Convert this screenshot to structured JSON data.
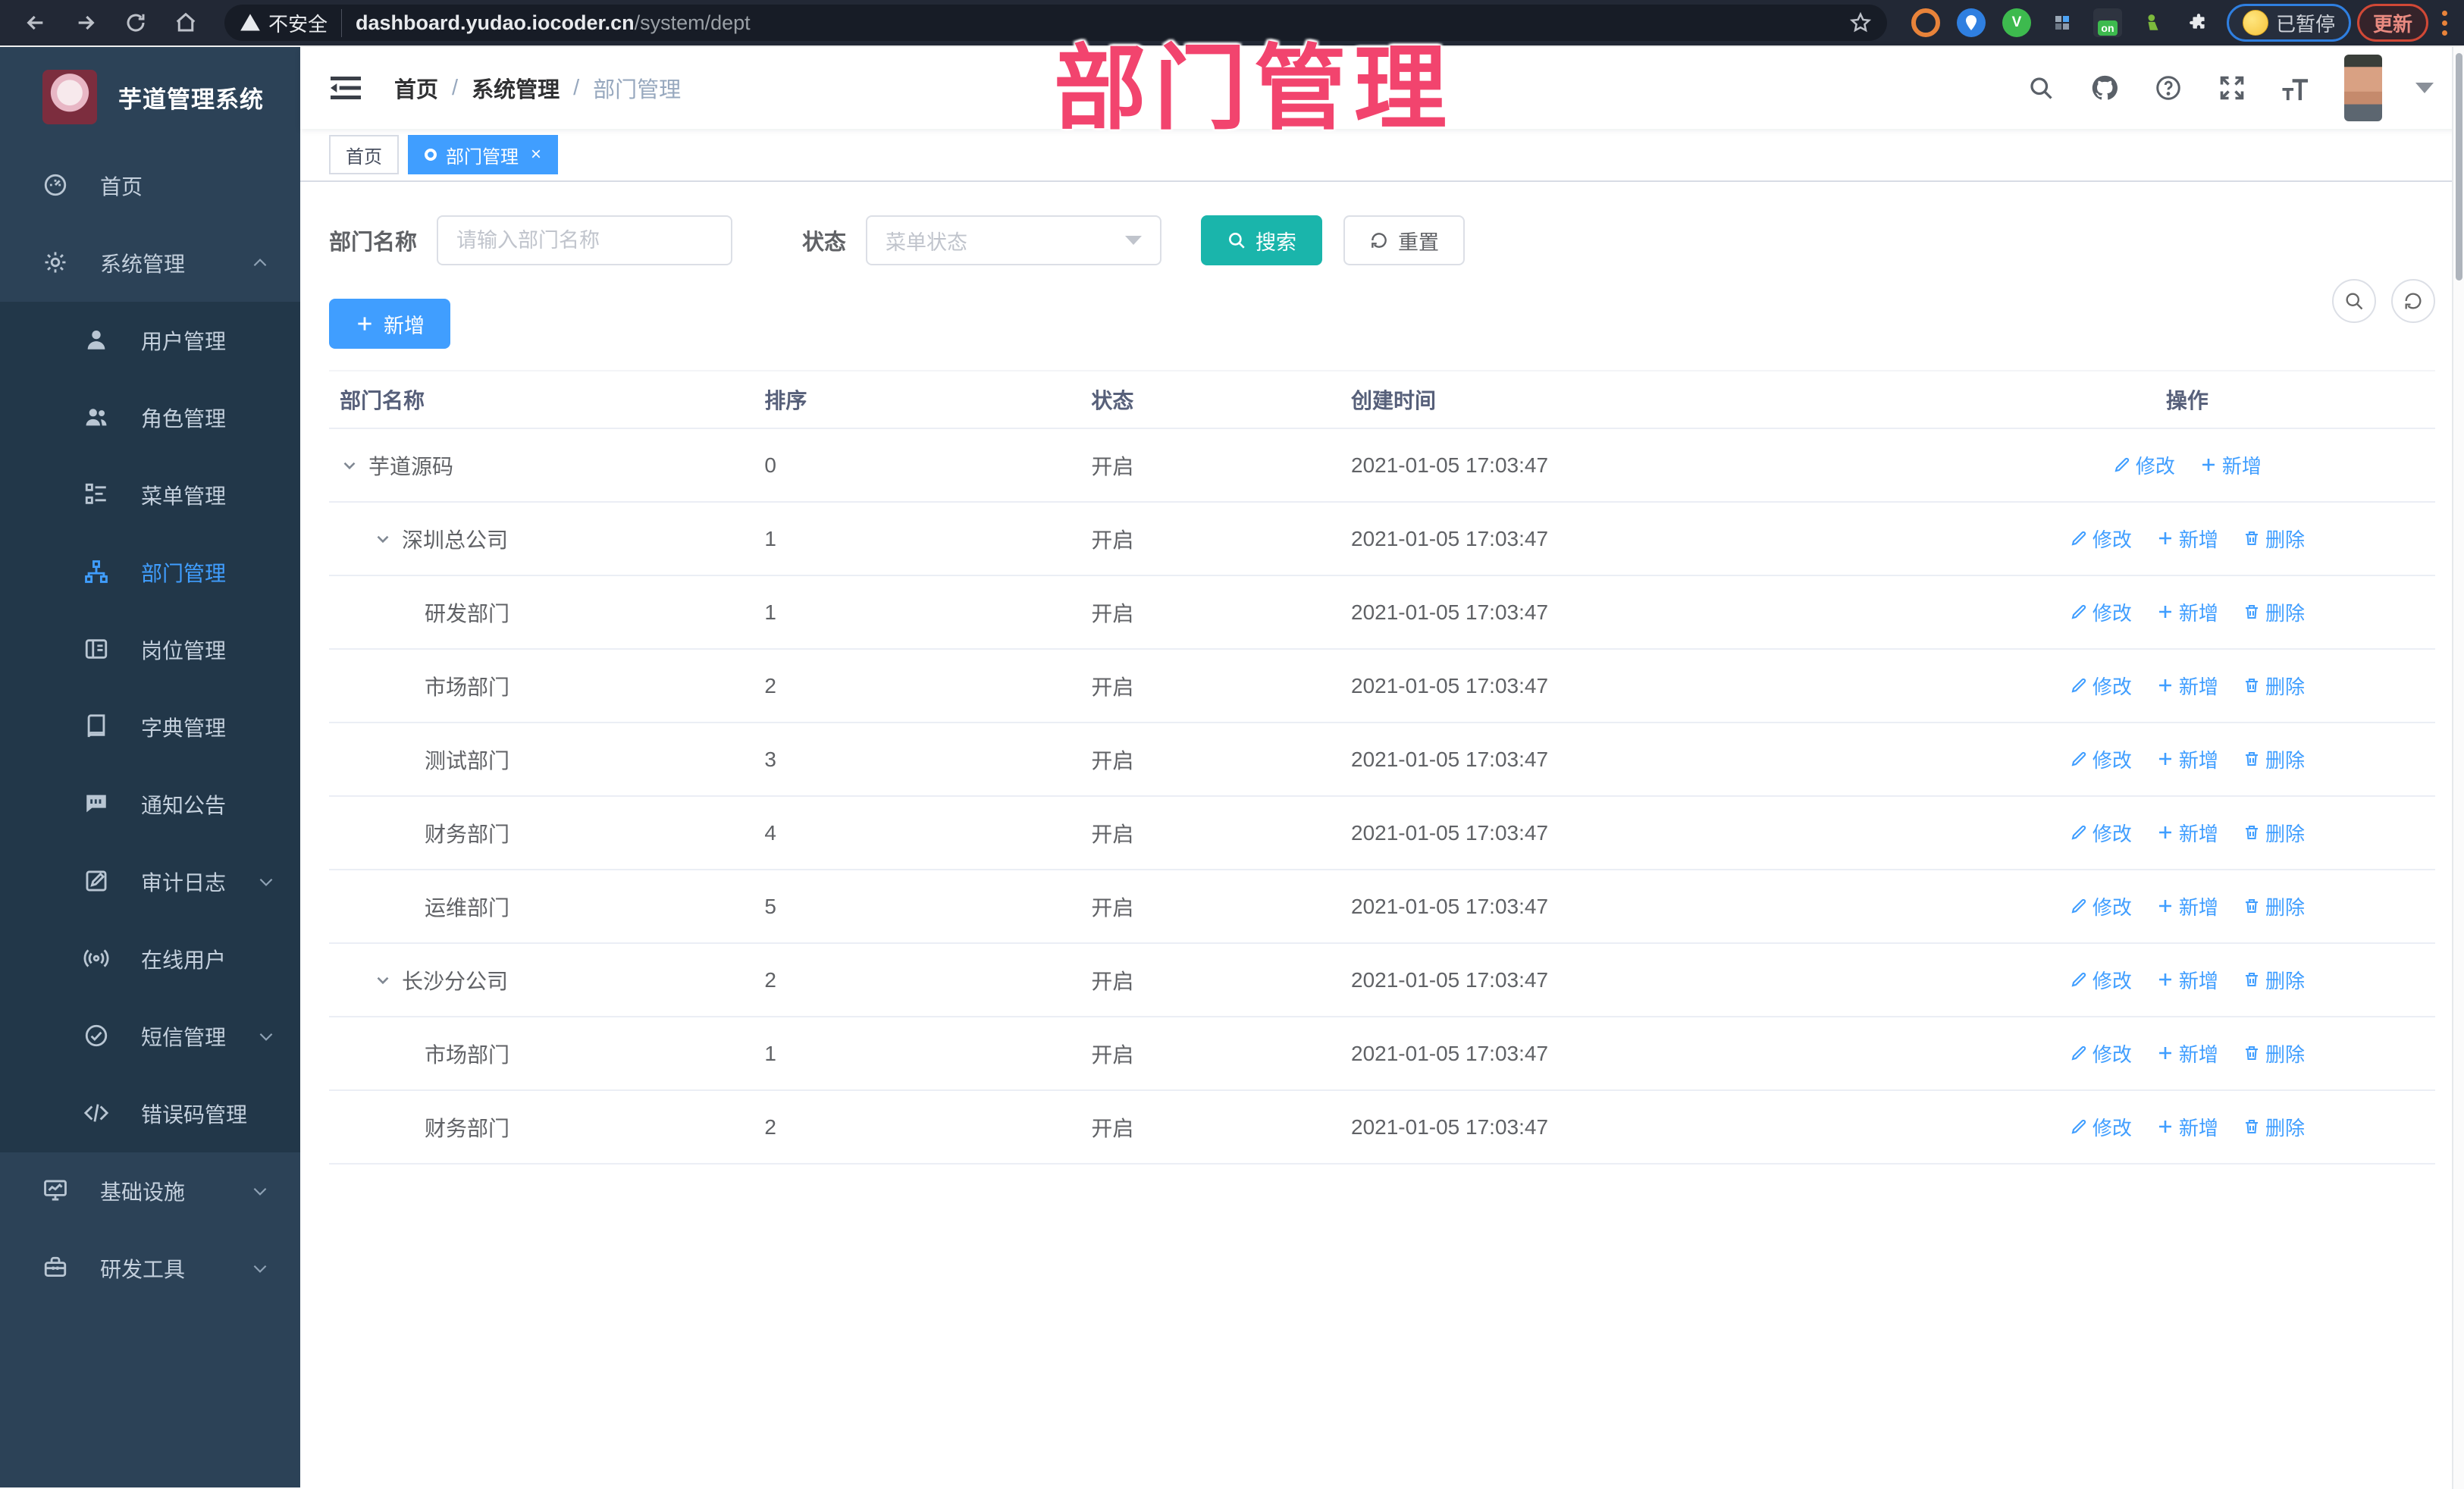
{
  "colors": {
    "accent_blue": "#409eff",
    "search_teal": "#1ab5ab",
    "annotation_pink": "#f2446e",
    "sidebar_bg": "#2c4257",
    "submenu_bg": "#223749"
  },
  "overlay_title": "部门管理",
  "browser": {
    "security_label": "不安全",
    "url_host": "dashboard.yudao.iocoder.cn",
    "url_path": "/system/dept",
    "paused_label": "已暂停",
    "update_label": "更新",
    "extensions": [
      {
        "icon": "orange-ring-extension-icon",
        "bg": "#e8833a",
        "glyph": ""
      },
      {
        "icon": "map-pin-extension-icon",
        "bg": "#2f7fe0",
        "glyph": ""
      },
      {
        "icon": "green-check-extension-icon",
        "bg": "#3dba4e",
        "glyph": "V"
      },
      {
        "icon": "grid-extension-icon",
        "bg": "#5a6573",
        "glyph": ""
      },
      {
        "icon": "list-on-extension-icon",
        "bg": "#2e3440",
        "glyph": "on"
      },
      {
        "icon": "green-bot-extension-icon",
        "bg": "#7cb93c",
        "glyph": ""
      },
      {
        "icon": "puzzle-extension-icon",
        "bg": "#e8eaed",
        "glyph": ""
      }
    ]
  },
  "sidebar": {
    "app_title": "芋道管理系统",
    "menu": [
      {
        "label": "首页",
        "icon": "dashboard-icon",
        "kind": "item"
      },
      {
        "label": "系统管理",
        "icon": "gear-icon",
        "kind": "group",
        "chevron": "up",
        "children": [
          {
            "label": "用户管理",
            "icon": "user-icon"
          },
          {
            "label": "角色管理",
            "icon": "users-icon"
          },
          {
            "label": "菜单管理",
            "icon": "tree-list-icon"
          },
          {
            "label": "部门管理",
            "icon": "org-chart-icon",
            "active": true
          },
          {
            "label": "岗位管理",
            "icon": "id-card-icon"
          },
          {
            "label": "字典管理",
            "icon": "book-icon"
          },
          {
            "label": "通知公告",
            "icon": "announcement-icon"
          },
          {
            "label": "审计日志",
            "icon": "audit-log-icon",
            "chevron": "down"
          },
          {
            "label": "在线用户",
            "icon": "online-user-icon"
          },
          {
            "label": "短信管理",
            "icon": "sms-check-icon",
            "chevron": "down"
          },
          {
            "label": "错误码管理",
            "icon": "code-icon"
          }
        ]
      },
      {
        "label": "基础设施",
        "icon": "monitor-icon",
        "kind": "group",
        "chevron": "down"
      },
      {
        "label": "研发工具",
        "icon": "toolbox-icon",
        "kind": "group",
        "chevron": "down"
      }
    ]
  },
  "header": {
    "breadcrumb": [
      "首页",
      "系统管理",
      "部门管理"
    ]
  },
  "tabs": [
    {
      "label": "首页",
      "active": false,
      "closable": false
    },
    {
      "label": "部门管理",
      "active": true,
      "closable": true
    }
  ],
  "filters": {
    "dept_label": "部门名称",
    "dept_placeholder": "请输入部门名称",
    "status_label": "状态",
    "status_placeholder": "菜单状态",
    "search_label": "搜索",
    "reset_label": "重置"
  },
  "toolbar": {
    "add_label": "新增"
  },
  "table": {
    "headers": [
      "部门名称",
      "排序",
      "状态",
      "创建时间",
      "操作"
    ],
    "action_labels": {
      "edit": "修改",
      "add": "新增",
      "delete": "删除"
    },
    "rows": [
      {
        "name": "芋道源码",
        "level": 1,
        "expandable": true,
        "sort": "0",
        "status": "开启",
        "created": "2021-01-05 17:03:47",
        "actions": [
          "edit",
          "add"
        ]
      },
      {
        "name": "深圳总公司",
        "level": 2,
        "expandable": true,
        "sort": "1",
        "status": "开启",
        "created": "2021-01-05 17:03:47",
        "actions": [
          "edit",
          "add",
          "delete"
        ]
      },
      {
        "name": "研发部门",
        "level": 3,
        "expandable": false,
        "sort": "1",
        "status": "开启",
        "created": "2021-01-05 17:03:47",
        "actions": [
          "edit",
          "add",
          "delete"
        ]
      },
      {
        "name": "市场部门",
        "level": 3,
        "expandable": false,
        "sort": "2",
        "status": "开启",
        "created": "2021-01-05 17:03:47",
        "actions": [
          "edit",
          "add",
          "delete"
        ]
      },
      {
        "name": "测试部门",
        "level": 3,
        "expandable": false,
        "sort": "3",
        "status": "开启",
        "created": "2021-01-05 17:03:47",
        "actions": [
          "edit",
          "add",
          "delete"
        ]
      },
      {
        "name": "财务部门",
        "level": 3,
        "expandable": false,
        "sort": "4",
        "status": "开启",
        "created": "2021-01-05 17:03:47",
        "actions": [
          "edit",
          "add",
          "delete"
        ]
      },
      {
        "name": "运维部门",
        "level": 3,
        "expandable": false,
        "sort": "5",
        "status": "开启",
        "created": "2021-01-05 17:03:47",
        "actions": [
          "edit",
          "add",
          "delete"
        ]
      },
      {
        "name": "长沙分公司",
        "level": 2,
        "expandable": true,
        "sort": "2",
        "status": "开启",
        "created": "2021-01-05 17:03:47",
        "actions": [
          "edit",
          "add",
          "delete"
        ]
      },
      {
        "name": "市场部门",
        "level": 3,
        "expandable": false,
        "sort": "1",
        "status": "开启",
        "created": "2021-01-05 17:03:47",
        "actions": [
          "edit",
          "add",
          "delete"
        ]
      },
      {
        "name": "财务部门",
        "level": 3,
        "expandable": false,
        "sort": "2",
        "status": "开启",
        "created": "2021-01-05 17:03:47",
        "actions": [
          "edit",
          "add",
          "delete"
        ]
      }
    ]
  }
}
